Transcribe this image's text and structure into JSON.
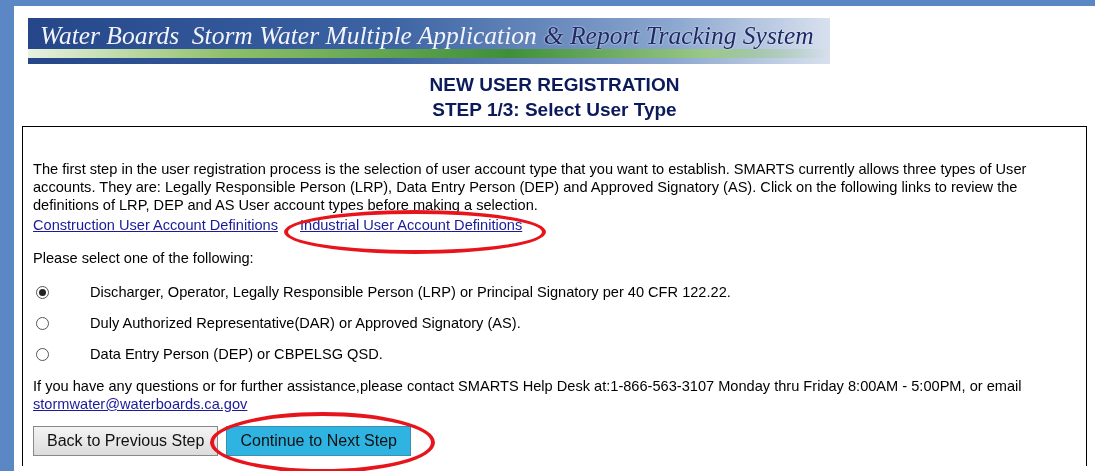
{
  "banner": {
    "title_main": "Water Boards  Storm Water Multiple Application",
    "title_accent": "& Report Tracking System"
  },
  "heading": [
    "NEW USER REGISTRATION",
    "STEP 1/3: Select User Type"
  ],
  "intro": "The first step in the user registration process is the selection of user account type that you want to establish. SMARTS currently allows three types of User accounts. They are: Legally Responsible Person (LRP), Data Entry Person (DEP) and Approved Signatory (AS). Click on the following links to review the definitions of LRP, DEP and AS User account types before making a selection.",
  "links": [
    {
      "label": "Construction User Account Definitions",
      "circled": false
    },
    {
      "label": "Industrial User Account Definitions",
      "circled": true
    }
  ],
  "prompt": "Please select one of the following:",
  "options": [
    {
      "label": "Discharger, Operator, Legally Responsible Person (LRP) or Principal Signatory per 40 CFR 122.22.",
      "selected": true
    },
    {
      "label": "Duly Authorized Representative(DAR) or Approved Signatory (AS).",
      "selected": false
    },
    {
      "label": "Data Entry Person (DEP) or CBPELSG QSD.",
      "selected": false
    }
  ],
  "help": "If you have any questions or for further assistance,please contact SMARTS Help Desk at:1-866-563-3107 Monday thru Friday 8:00AM - 5:00PM, or email",
  "email": "stormwater@waterboards.ca.gov",
  "buttons": [
    {
      "label": "Back to Previous Step",
      "kind": "secondary",
      "circled": false
    },
    {
      "label": "Continue to Next Step",
      "kind": "primary",
      "circled": true
    }
  ]
}
